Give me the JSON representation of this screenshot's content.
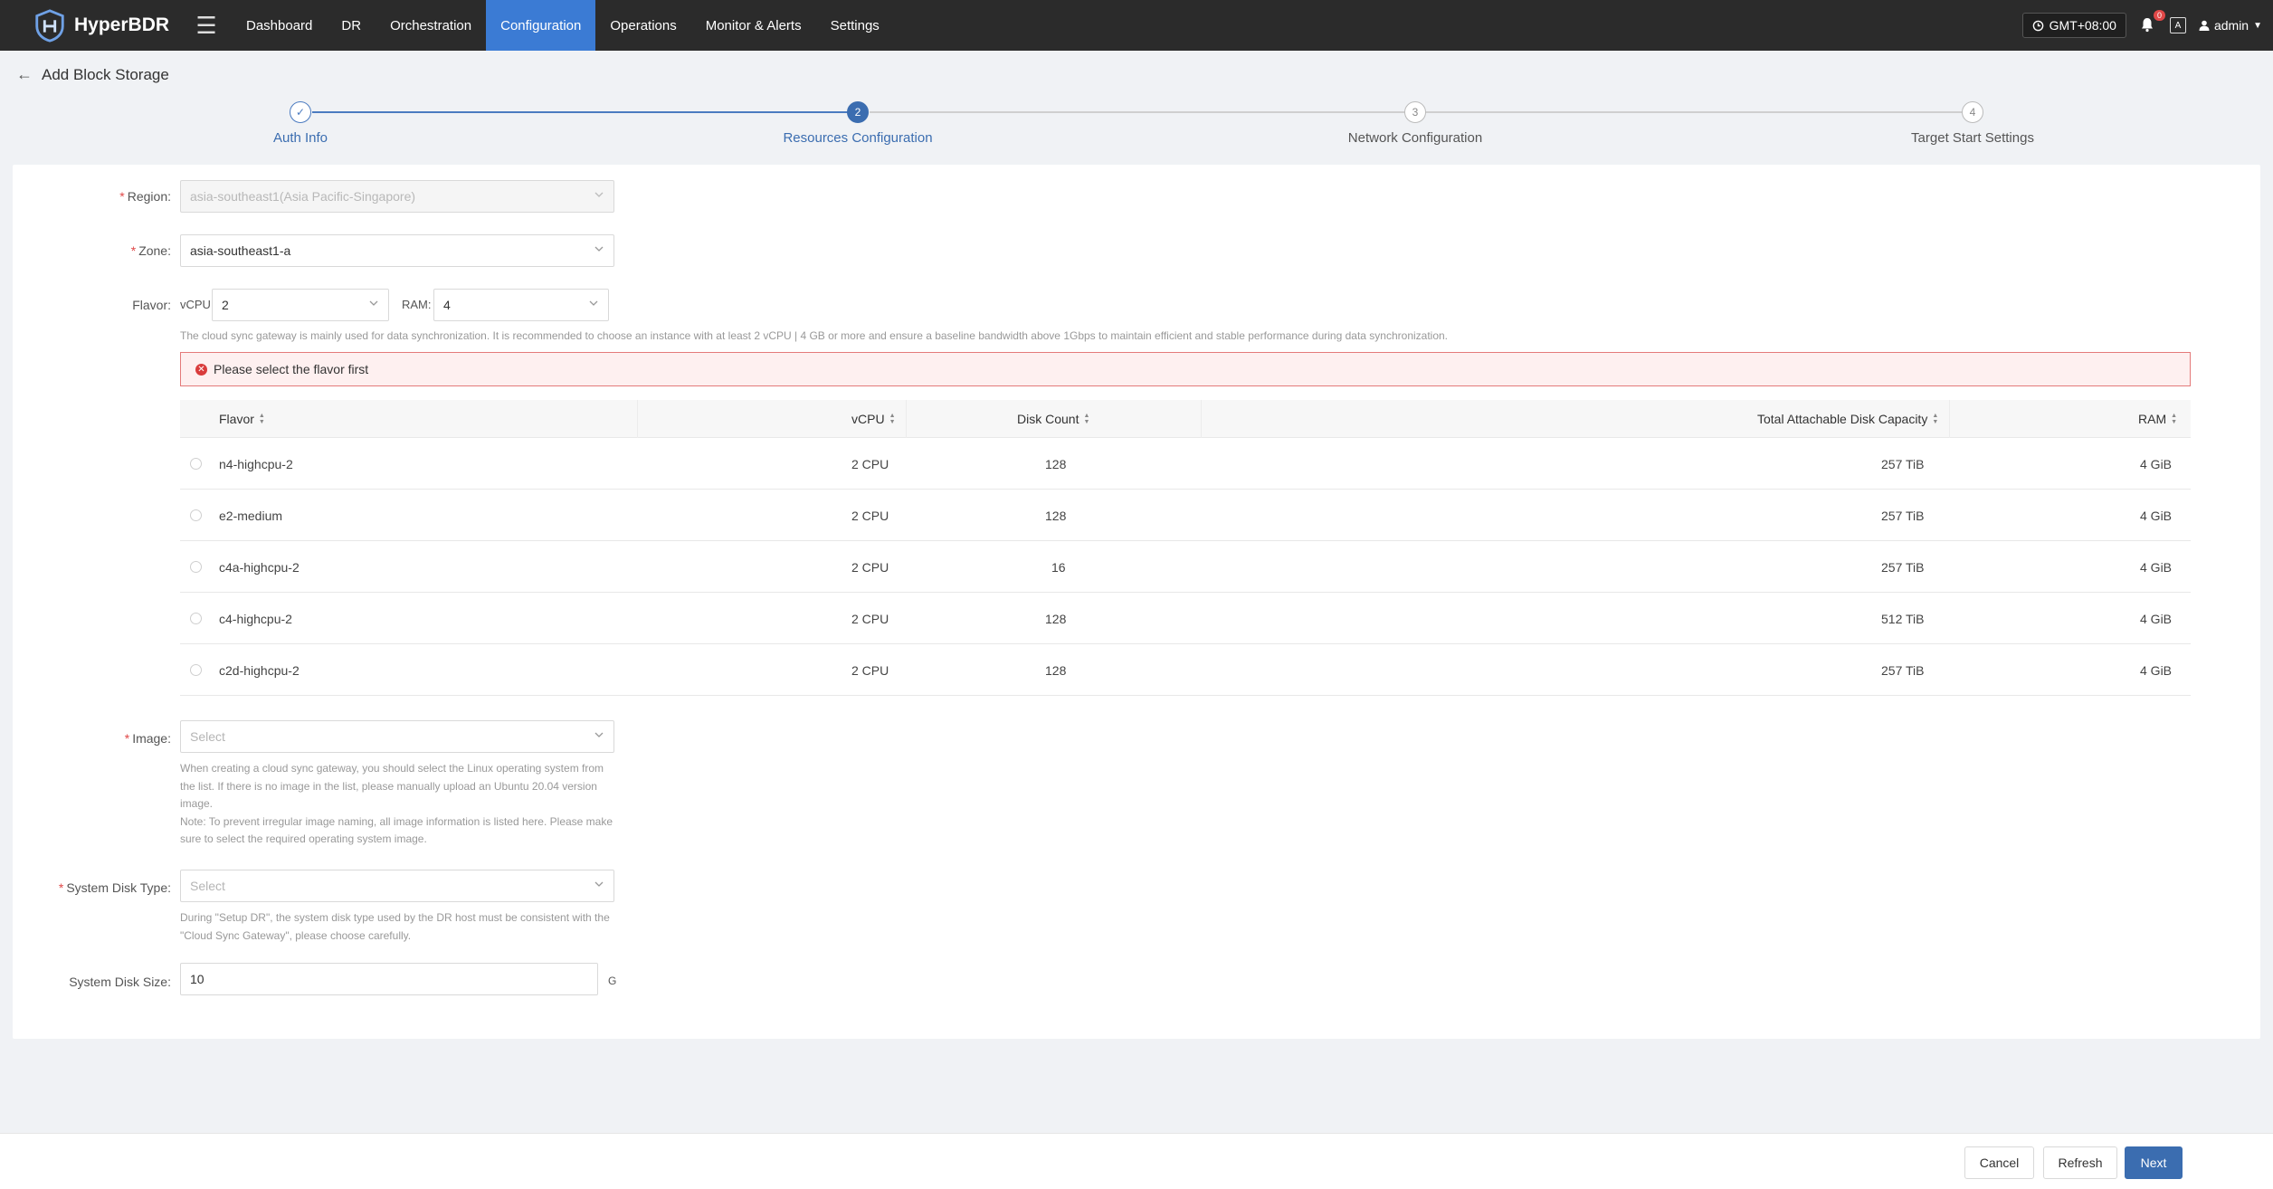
{
  "app": {
    "name": "HyperBDR"
  },
  "nav": {
    "items": [
      "Dashboard",
      "DR",
      "Orchestration",
      "Configuration",
      "Operations",
      "Monitor & Alerts",
      "Settings"
    ],
    "active": "Configuration",
    "timezone": "GMT+08:00",
    "notification_count": "0",
    "user": "admin"
  },
  "page": {
    "title": "Add Block Storage"
  },
  "steps": [
    {
      "index": "1",
      "label": "Auth Info",
      "state": "done"
    },
    {
      "index": "2",
      "label": "Resources Configuration",
      "state": "active"
    },
    {
      "index": "3",
      "label": "Network Configuration",
      "state": "pending"
    },
    {
      "index": "4",
      "label": "Target Start Settings",
      "state": "pending"
    }
  ],
  "form": {
    "region": {
      "label": "Region:",
      "value": "asia-southeast1(Asia Pacific-Singapore)"
    },
    "zone": {
      "label": "Zone:",
      "value": "asia-southeast1-a"
    },
    "flavor": {
      "label": "Flavor:",
      "vcpu_label": "vCPU:",
      "vcpu_value": "2",
      "ram_label": "RAM:",
      "ram_value": "4",
      "hint": "The cloud sync gateway is mainly used for data synchronization. It is recommended to choose an instance with at least 2 vCPU | 4 GB or more and ensure a baseline bandwidth above 1Gbps to maintain efficient and stable performance during data synchronization.",
      "error": "Please select the flavor first"
    },
    "image": {
      "label": "Image:",
      "placeholder": "Select",
      "hint_lines": [
        "When creating a cloud sync gateway, you should select the Linux operating system from",
        "the list. If there is no image in the list, please manually upload an Ubuntu 20.04 version",
        "image.",
        "Note: To prevent irregular image naming, all image information is listed here. Please make",
        "sure to select the required operating system image."
      ]
    },
    "system_disk_type": {
      "label": "System Disk Type:",
      "placeholder": "Select",
      "hint_lines": [
        "During \"Setup DR\", the system disk type used by the DR host must be consistent with the",
        "\"Cloud Sync Gateway\", please choose carefully."
      ]
    },
    "system_disk_size": {
      "label": "System Disk Size:",
      "value": "10",
      "unit": "G"
    }
  },
  "table": {
    "headers": [
      "Flavor",
      "vCPU",
      "Disk Count",
      "Total Attachable Disk Capacity",
      "RAM"
    ],
    "rows": [
      [
        "n4-highcpu-2",
        "2 CPU",
        "128",
        "257 TiB",
        "4 GiB"
      ],
      [
        "e2-medium",
        "2 CPU",
        "128",
        "257 TiB",
        "4 GiB"
      ],
      [
        "c4a-highcpu-2",
        "2 CPU",
        "16",
        "257 TiB",
        "4 GiB"
      ],
      [
        "c4-highcpu-2",
        "2 CPU",
        "128",
        "512 TiB",
        "4 GiB"
      ],
      [
        "c2d-highcpu-2",
        "2 CPU",
        "128",
        "257 TiB",
        "4 GiB"
      ]
    ]
  },
  "footer": {
    "cancel": "Cancel",
    "refresh": "Refresh",
    "next": "Next"
  }
}
